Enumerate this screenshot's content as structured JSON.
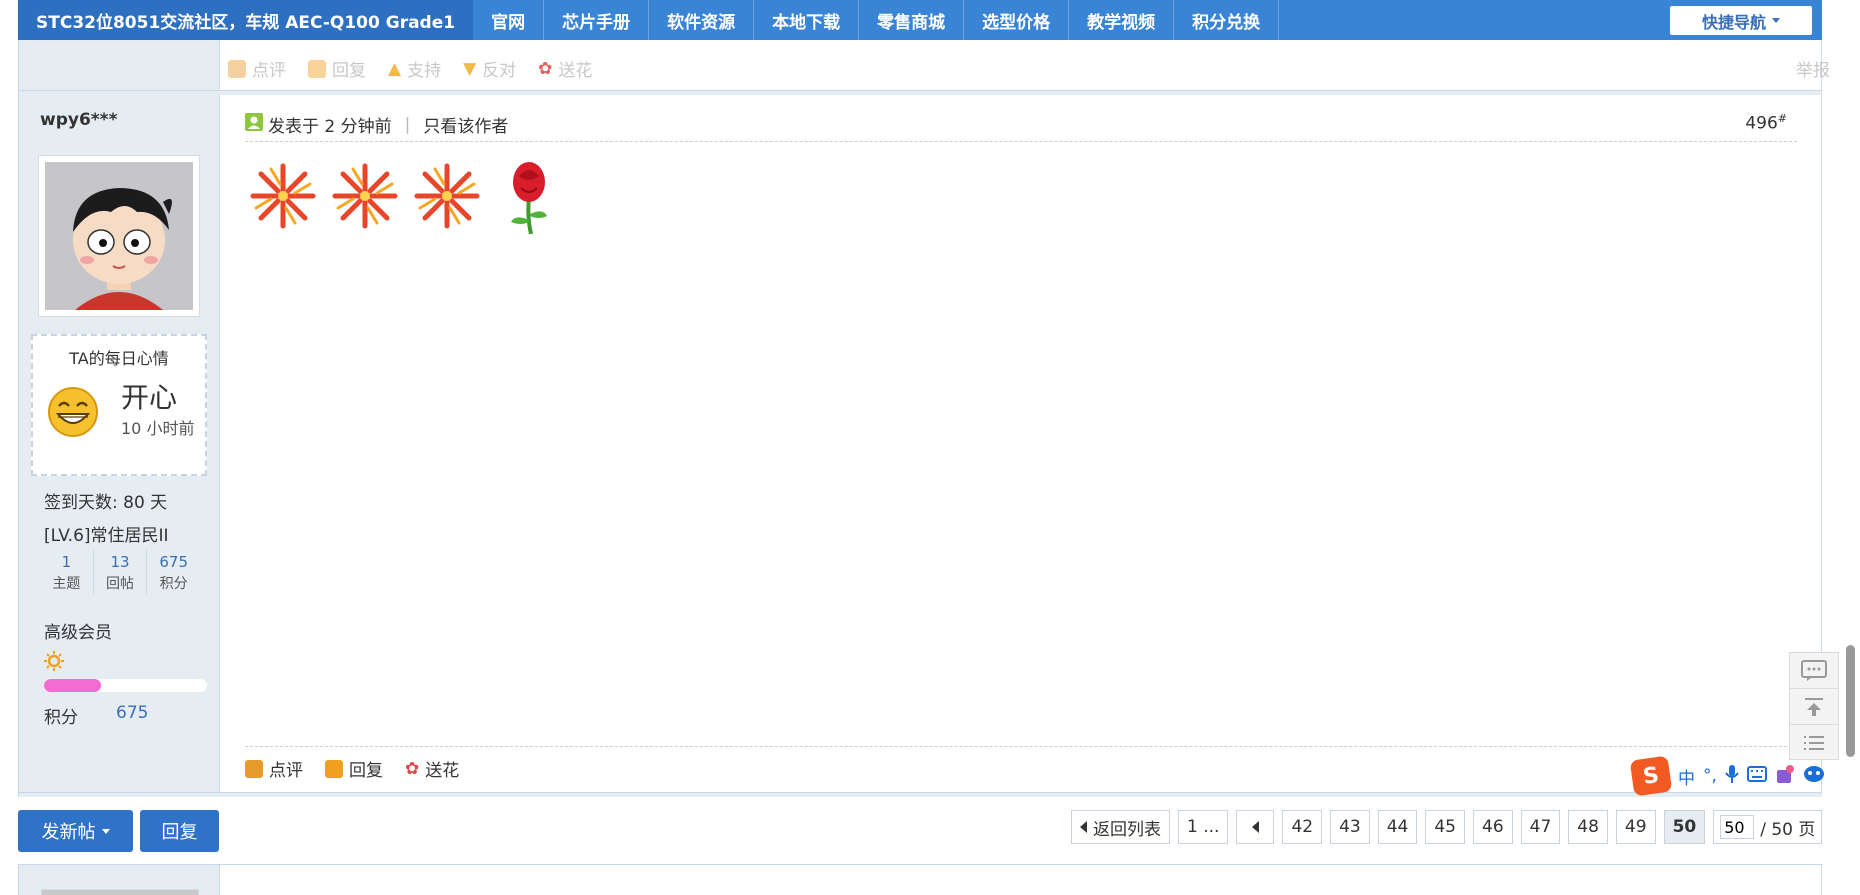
{
  "nav": {
    "brand": "STC32位8051交流社区，车规 AEC-Q100 Grade1",
    "items": [
      "官网",
      "芯片手册",
      "软件资源",
      "本地下载",
      "零售商城",
      "选型价格",
      "教学视频",
      "积分兑换"
    ],
    "quick_nav": "快捷导航"
  },
  "prev_post": {
    "actions": [
      "点评",
      "回复",
      "支持",
      "反对",
      "送花"
    ],
    "report": "举报"
  },
  "user": {
    "name": "wpy6***",
    "mood_title": "TA的每日心情",
    "mood_word": "开心",
    "mood_time": "10 小时前",
    "signin": "签到天数: 80 天",
    "level": "[LV.6]常住居民II",
    "stats": [
      {
        "num": "1",
        "label": "主题"
      },
      {
        "num": "13",
        "label": "回帖"
      },
      {
        "num": "675",
        "label": "积分"
      }
    ],
    "grade": "高级会员",
    "progress": 0.35,
    "points_label": "积分",
    "points_value": "675"
  },
  "post": {
    "posted": "发表于 2 分钟前",
    "only_author": "只看该作者",
    "floor": "496",
    "floor_mark": "#",
    "emojis": [
      "fireworks",
      "fireworks",
      "fireworks",
      "rose"
    ],
    "footer_actions": [
      "点评",
      "回复",
      "送花"
    ]
  },
  "ime": {
    "logo": "S",
    "mode": "中",
    "punct": "°,"
  },
  "toolbar": {
    "new_post": "发新帖",
    "reply": "回复",
    "back_to_list": "返回列表",
    "first_page": "1 ...",
    "pages": [
      "42",
      "43",
      "44",
      "45",
      "46",
      "47",
      "48",
      "49"
    ],
    "current_page": "50",
    "page_input": "50",
    "total_pages": "/ 50 页"
  },
  "colors": {
    "nav_bg": "#3a84d6",
    "brand_bg": "#2d6fc0",
    "side_bg": "#e5edf2",
    "button_blue": "#2f73c9",
    "progress": "#f46bd2",
    "link_blue": "#3a6fb8"
  }
}
